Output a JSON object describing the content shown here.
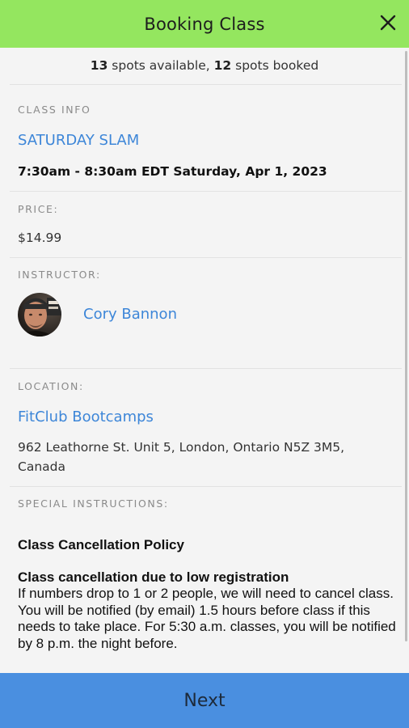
{
  "header": {
    "title": "Booking Class",
    "close_icon": "close-icon"
  },
  "availability": {
    "available_count": "13",
    "available_text": " spots available, ",
    "booked_count": "12",
    "booked_text": " spots booked"
  },
  "class_info": {
    "label": "CLASS INFO",
    "name": "SATURDAY SLAM",
    "time": "7:30am - 8:30am EDT Saturday, Apr 1, 2023"
  },
  "price": {
    "label": "PRICE:",
    "value": "$14.99"
  },
  "instructor": {
    "label": "INSTRUCTOR:",
    "name": "Cory Bannon",
    "avatar_icon": "avatar"
  },
  "location": {
    "label": "LOCATION:",
    "name": "FitClub Bootcamps",
    "address_line1": "962 Leathorne St. Unit 5, London, Ontario N5Z 3M5,",
    "address_line2": "Canada"
  },
  "special_instructions": {
    "label": "SPECIAL INSTRUCTIONS:",
    "policy_title": "Class Cancellation Policy",
    "policy_subtitle": "Class cancellation due to low registration",
    "policy_body": "If numbers drop to 1 or 2 people, we will need to cancel class. You will be notified (by email) 1.5 hours before class if this needs to take place. For 5:30 a.m. classes, you will be notified by 8 p.m. the night before."
  },
  "footer": {
    "next_label": "Next"
  },
  "colors": {
    "header_bg": "#94e65f",
    "link": "#3d86d8",
    "footer_bg": "#4a8fe0",
    "page_bg": "#f4f4f4"
  }
}
